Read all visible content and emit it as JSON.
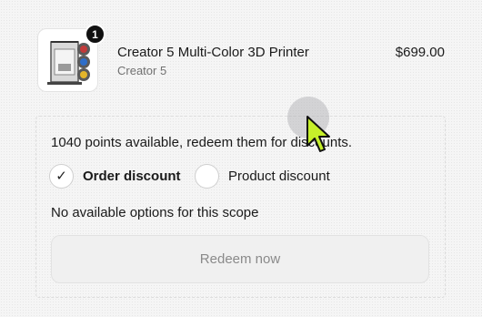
{
  "product": {
    "quantity": "1",
    "name": "Creator 5 Multi-Color 3D Printer",
    "variant": "Creator 5",
    "price": "$699.00",
    "image_icon": "3d-printer"
  },
  "rewards": {
    "points_text": "1040 points available, redeem them for discounts.",
    "options": [
      {
        "label": "Order discount",
        "selected": true
      },
      {
        "label": "Product discount",
        "selected": false
      }
    ],
    "empty_text": "No available options for this scope",
    "redeem_label": "Redeem now",
    "redeem_disabled": true
  },
  "colors": {
    "accent_cursor": "#c6f02a",
    "badge": "#111111",
    "disabled_text": "#8a8a8a"
  }
}
